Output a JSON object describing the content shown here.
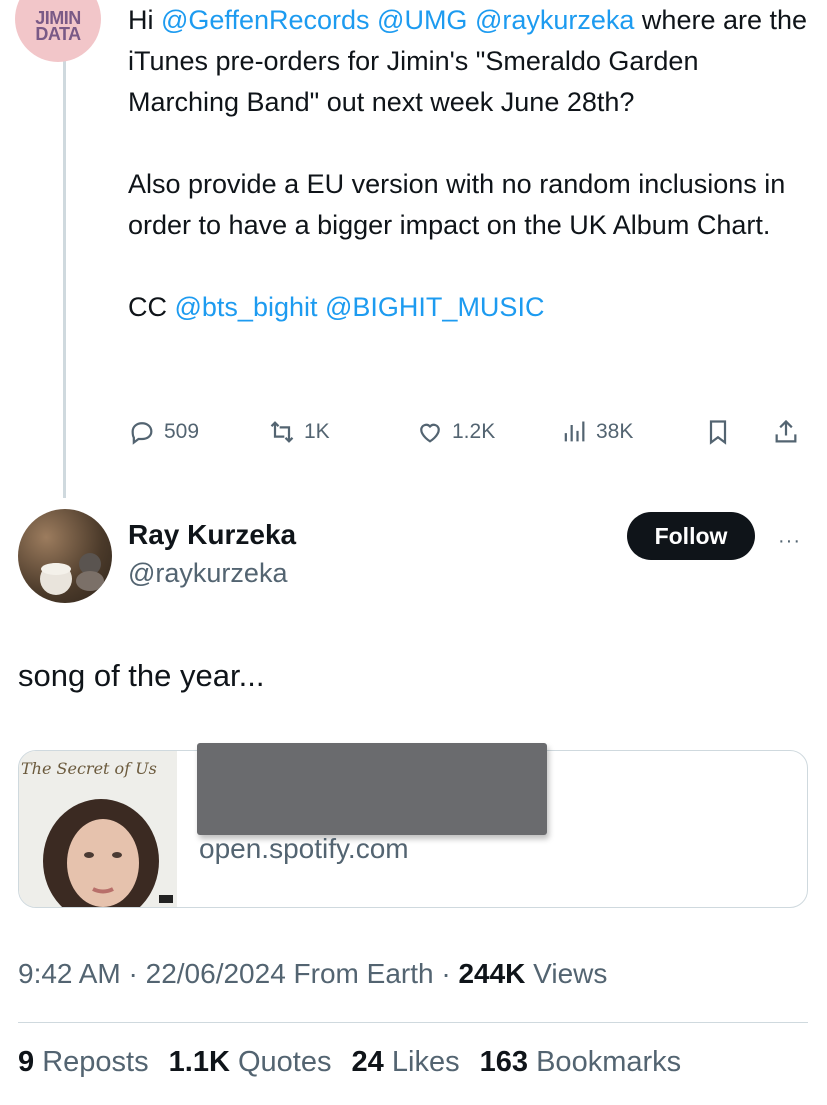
{
  "quoted_tweet": {
    "avatar_label": "JIMIN DATA",
    "paragraphs": [
      {
        "prefix": "Hi ",
        "mentions": [
          "@GeffenRecords",
          "@UMG",
          "@raykurzeka"
        ],
        "suffix": " where are the iTunes pre-orders for Jimin's \"Smeraldo Garden Marching Band\" out next week June 28th?"
      },
      "Also provide a EU version with no random inclusions in order to have a bigger impact on the UK Album Chart.",
      {
        "prefix": "CC ",
        "mentions": [
          "@bts_bighit",
          "@BIGHIT_MUSIC"
        ]
      }
    ],
    "actions": {
      "replies": "509",
      "reposts": "1K",
      "likes": "1.2K",
      "views": "38K"
    }
  },
  "tweet": {
    "display_name": "Ray Kurzeka",
    "handle": "@raykurzeka",
    "follow_label": "Follow",
    "more_label": "···",
    "text": "song of the year...",
    "link_card": {
      "thumb_title": "The Secret of Us",
      "domain": "open.spotify.com"
    },
    "meta": {
      "time": "9:42 AM",
      "sep1": " · ",
      "date": "22/06/2024",
      "source": " From Earth",
      "sep2": " · ",
      "views_count": "244K",
      "views_label": " Views"
    },
    "stats": [
      {
        "count": "9",
        "label": "Reposts"
      },
      {
        "count": "1.1K",
        "label": "Quotes"
      },
      {
        "count": "24",
        "label": "Likes"
      },
      {
        "count": "163",
        "label": "Bookmarks"
      }
    ]
  },
  "colors": {
    "accent": "#1d9bf0",
    "text": "#0f1419",
    "secondary": "#536471",
    "border": "#cfd9de"
  }
}
